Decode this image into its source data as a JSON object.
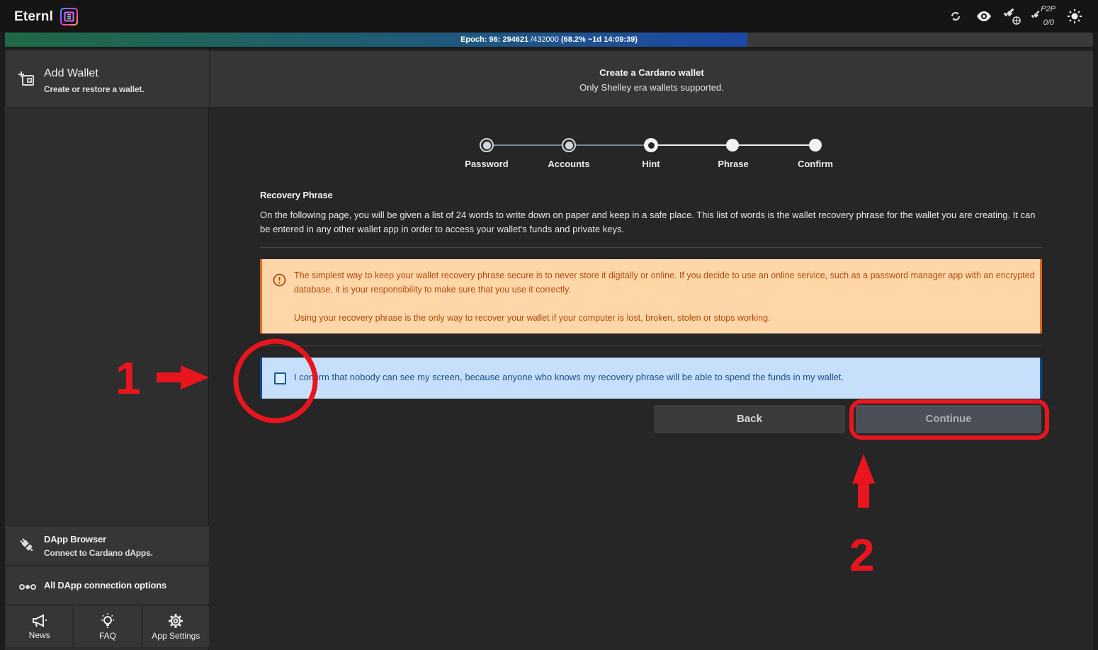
{
  "app": {
    "name": "Eternl"
  },
  "topbar": {
    "icons": [
      "sync-icon",
      "eye-icon",
      "satellite-icon",
      "p2p-icon",
      "sun-icon"
    ],
    "p2p_label": "P2P",
    "p2p_count": "0/0"
  },
  "epoch": {
    "prefix": "Epoch: 96: 294621",
    "total": " /432000 ",
    "detail": "(68.2% ~1d 14:09:39)",
    "progress_percent": 68.2,
    "fill_color": "#1d48a8"
  },
  "sidebar": {
    "header": {
      "title": "Add Wallet",
      "subtitle": "Create or restore a wallet."
    },
    "dapp_browser": {
      "title": "DApp Browser",
      "subtitle": "Connect to Cardano dApps."
    },
    "all_dapp": {
      "title": "All DApp connection options"
    },
    "bottom_nav": [
      {
        "label": "News",
        "icon": "megaphone-icon"
      },
      {
        "label": "FAQ",
        "icon": "lightbulb-icon"
      },
      {
        "label": "App Settings",
        "icon": "gear-icon"
      }
    ]
  },
  "main": {
    "header": {
      "title": "Create a Cardano wallet",
      "subtitle": "Only Shelley era wallets supported."
    },
    "steps": [
      {
        "label": "Password",
        "state": "done"
      },
      {
        "label": "Accounts",
        "state": "done"
      },
      {
        "label": "Hint",
        "state": "current"
      },
      {
        "label": "Phrase",
        "state": "todo"
      },
      {
        "label": "Confirm",
        "state": "todo"
      }
    ],
    "section_title": "Recovery Phrase",
    "section_body": "On the following page, you will be given a list of 24 words to write down on paper and keep in a safe place. This list of words is the wallet recovery phrase for the wallet you are creating. It can be entered in any other wallet app in order to access your wallet's funds and private keys.",
    "warning": {
      "line1": "The simplest way to keep your wallet recovery phrase secure is to never store it digitally or online. If you decide to use an online service, such as a password manager app with an encrypted database, it is your responsibility to make sure that you use it correctly.",
      "line2": "Using your recovery phrase is the only way to recover your wallet if your computer is lost, broken, stolen or stops working."
    },
    "confirm_text": "I confirm that nobody can see my screen, because anyone who knows my recovery phrase will be able to spend the funds in my wallet.",
    "confirm_checked": false,
    "buttons": {
      "back": "Back",
      "continue": "Continue"
    }
  },
  "annotations": {
    "step1": "1",
    "step2": "2",
    "color": "#e8151f"
  }
}
